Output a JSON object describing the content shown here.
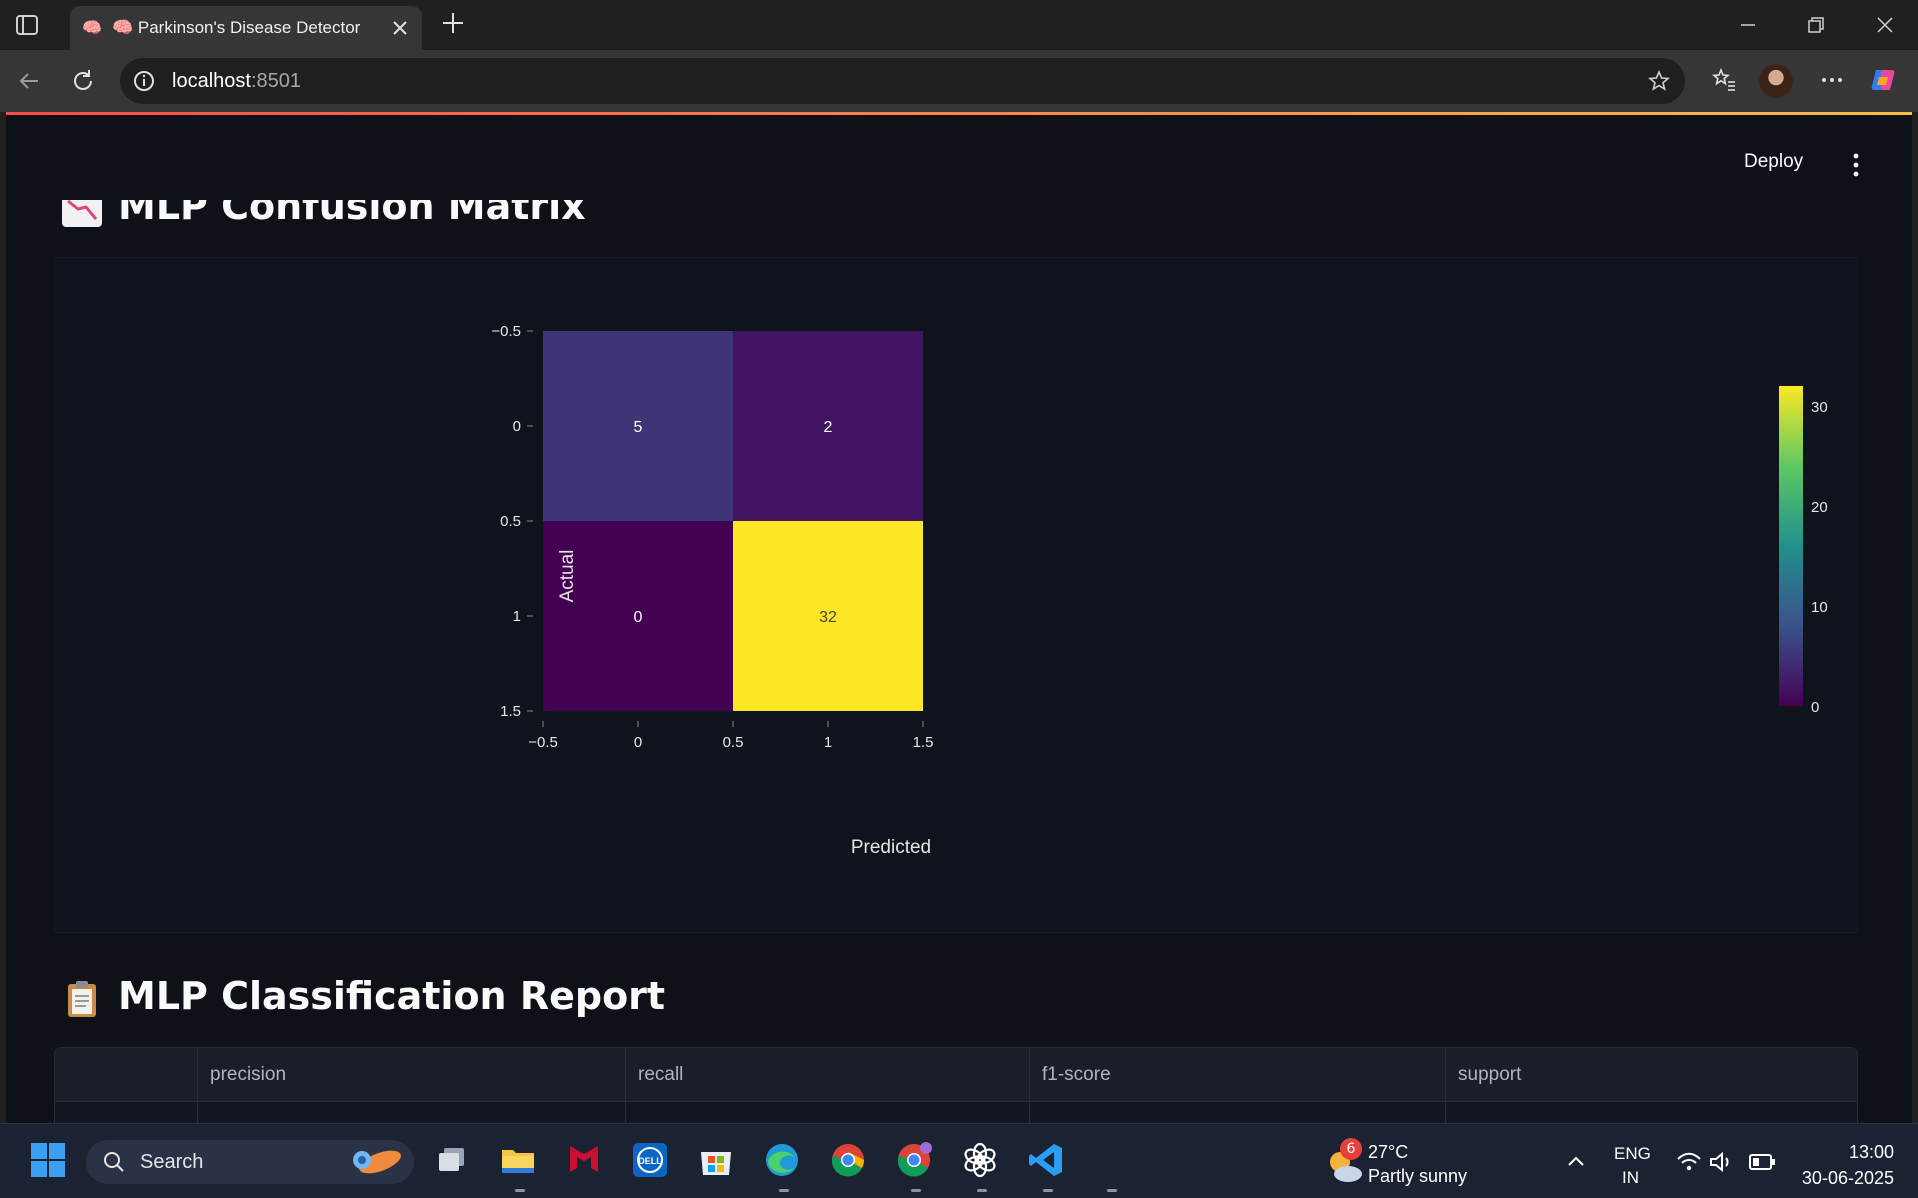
{
  "browser": {
    "tab_title": "Parkinson's Disease Detector",
    "tab_favicon_icon": "brain-icon",
    "url_host": "localhost",
    "url_port": ":8501"
  },
  "app": {
    "deploy_label": "Deploy",
    "confusion_title": "MLP Confusion Matrix",
    "report_title": "MLP Classification Report",
    "report_columns": [
      "precision",
      "recall",
      "f1-score",
      "support"
    ]
  },
  "chart_data": {
    "type": "heatmap",
    "xlabel": "Predicted",
    "ylabel": "Actual",
    "x_ticks": [
      "−0.5",
      "0",
      "0.5",
      "1",
      "1.5"
    ],
    "y_ticks": [
      "−0.5",
      "0",
      "0.5",
      "1",
      "1.5"
    ],
    "rows": [
      0,
      1
    ],
    "cols": [
      0,
      1
    ],
    "z": [
      [
        5,
        2
      ],
      [
        0,
        32
      ]
    ],
    "zlim": [
      0,
      32
    ],
    "colorscale": "viridis",
    "colorbar_ticks": [
      "30",
      "20",
      "10",
      "0"
    ],
    "colorbar_tick_values": [
      30,
      20,
      10,
      0
    ],
    "colors": {
      "text_light": "#ffffff",
      "text_dark": "#444444",
      "axis": "#e6e6e6"
    }
  },
  "taskbar": {
    "search_label": "Search",
    "weather_badge": "6",
    "weather_temp": "27°C",
    "weather_desc": "Partly sunny",
    "lang_line1": "ENG",
    "lang_line2": "IN",
    "time": "13:00",
    "date": "30-06-2025"
  }
}
